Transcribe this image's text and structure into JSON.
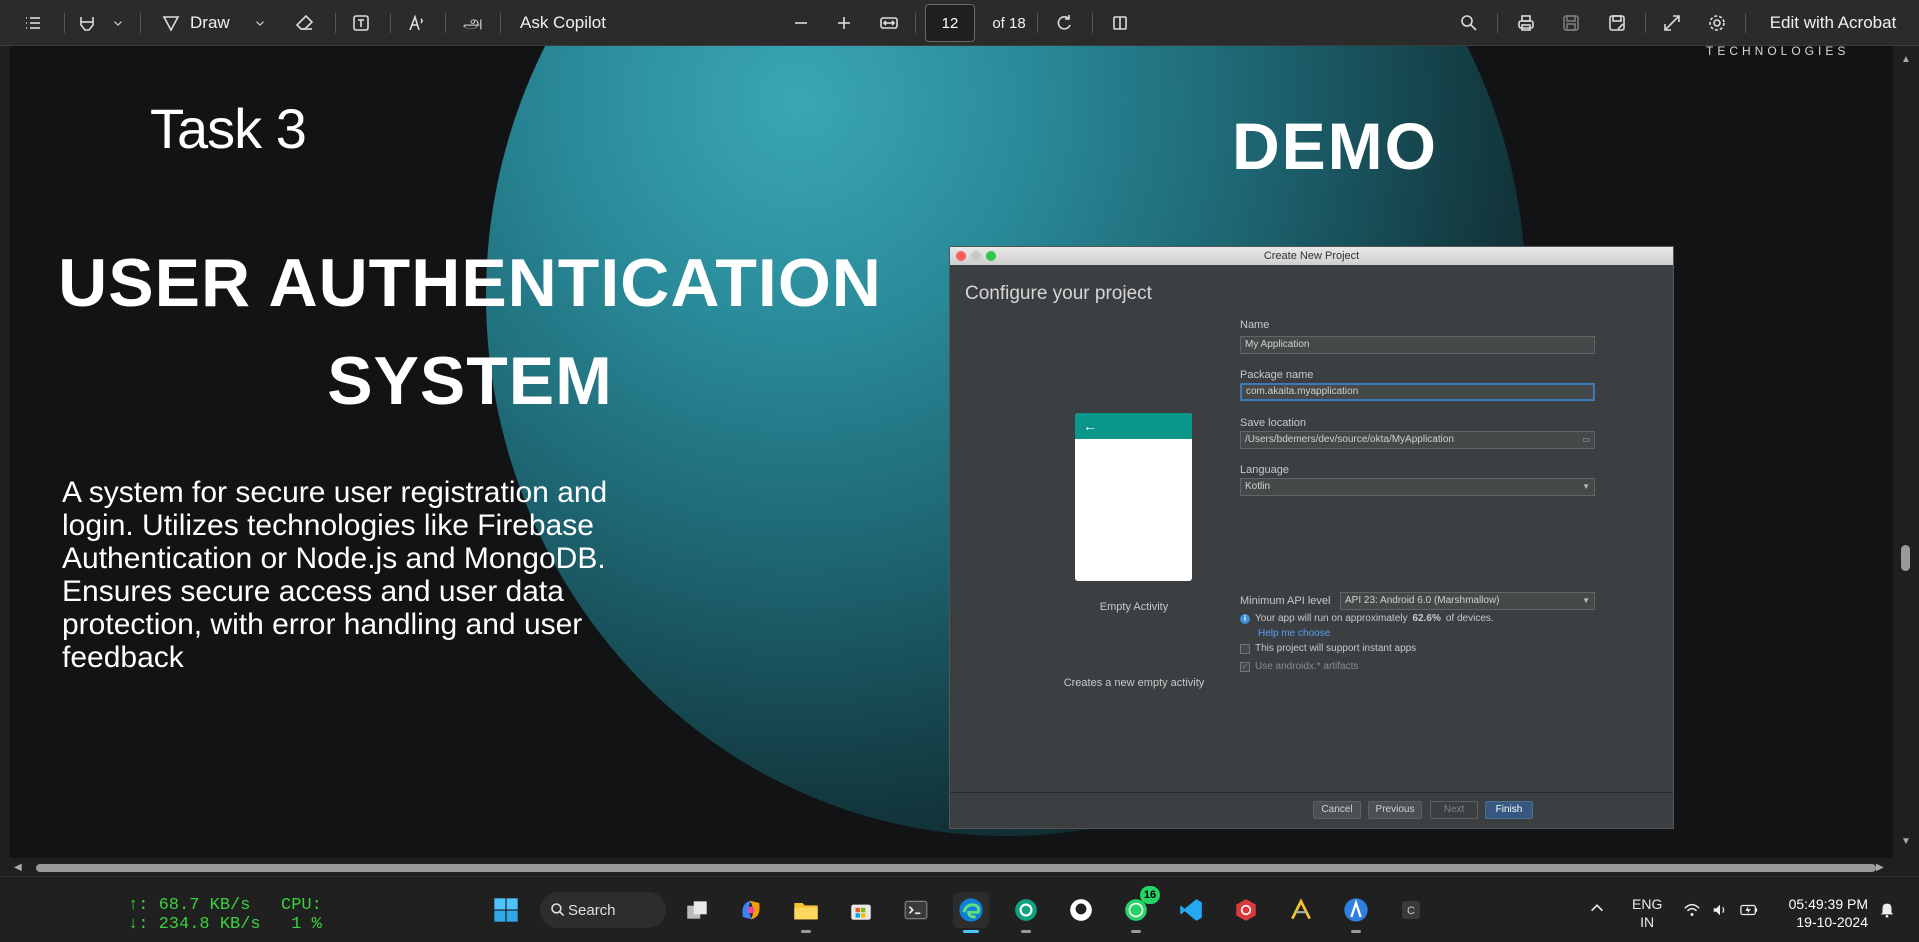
{
  "toolbar": {
    "draw_label": "Draw",
    "ask_copilot_label": "Ask Copilot",
    "current_page": "12",
    "page_total": "of 18",
    "edit_label": "Edit with Acrobat"
  },
  "slide": {
    "logo_text": "TECHNOLOGIES",
    "task_title": "Task 3",
    "demo_label": "DEMO",
    "main_title_line1": "USER AUTHENTICATION",
    "main_title_line2": "SYSTEM",
    "description": "A system for secure user registration and login. Utilizes technologies like Firebase Authentication or Node.js and MongoDB. Ensures secure access and user data protection, with error handling and user feedback",
    "accent_color": "#2a8b9a"
  },
  "dialog": {
    "window_title": "Create New Project",
    "heading": "Configure your project",
    "template_name": "Empty Activity",
    "template_desc": "Creates a new empty activity",
    "name_label": "Name",
    "name_value": "My Application",
    "package_label": "Package name",
    "package_value": "com.akaita.myapplication",
    "location_label": "Save location",
    "location_value": "/Users/bdemers/dev/source/okta/MyApplication",
    "language_label": "Language",
    "language_value": "Kotlin",
    "api_label": "Minimum API level",
    "api_value": "API 23: Android 6.0 (Marshmallow)",
    "info_prefix": "Your app will run on approximately",
    "info_percent": "62.6%",
    "info_suffix": "of devices.",
    "help_link": "Help me choose",
    "instant_apps_label": "This project will support instant apps",
    "instant_apps_checked": false,
    "androidx_label": "Use androidx.* artifacts",
    "androidx_checked": true,
    "buttons": {
      "cancel": "Cancel",
      "previous": "Previous",
      "next": "Next",
      "finish": "Finish"
    }
  },
  "taskbar": {
    "net_up": "↑: 68.7 KB/s",
    "net_down": "↓: 234.8 KB/s",
    "cpu_label": "CPU:",
    "cpu_value": "1 %",
    "search_label": "Search",
    "whatsapp_badge": "16",
    "lang_line1": "ENG",
    "lang_line2": "IN",
    "time": "05:49:39 PM",
    "date": "19-10-2024"
  }
}
